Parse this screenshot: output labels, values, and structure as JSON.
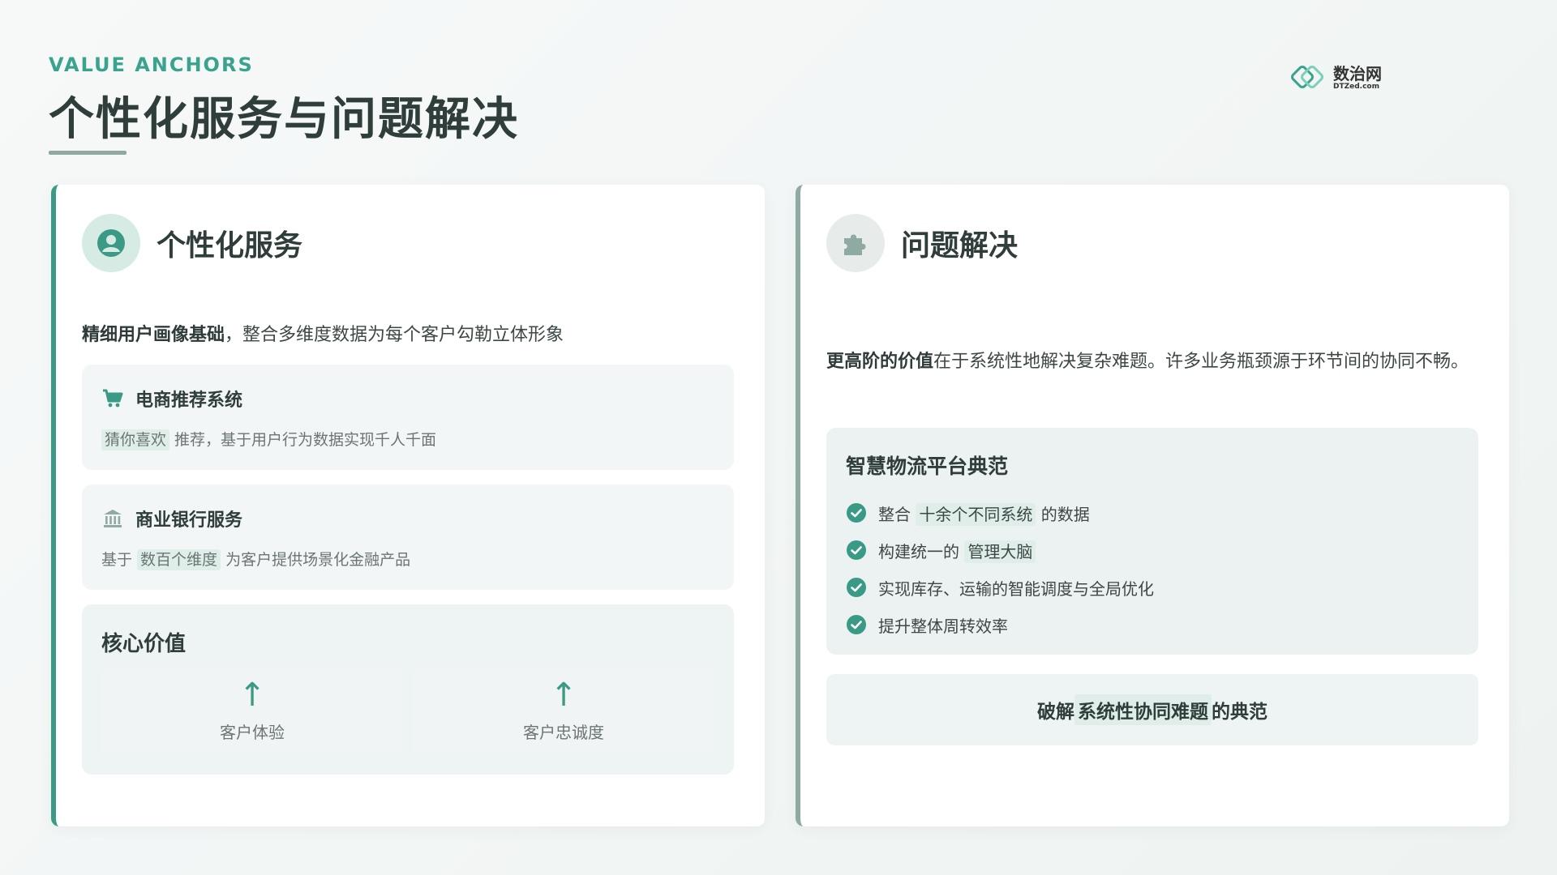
{
  "header": {
    "eyebrow": "VALUE ANCHORS",
    "title": "个性化服务与问题解决",
    "logo_cn": "数治网",
    "logo_en": "DTZed.com"
  },
  "colors": {
    "accent": "#3a9a86",
    "accent_muted": "#8fa9a3",
    "highlight_bg": "#e0eeea"
  },
  "left_card": {
    "title": "个性化服务",
    "icon": "user-circle-icon",
    "intro_bold": "精细用户画像基础",
    "intro_rest": "，整合多维度数据为每个客户勾勒立体形象",
    "features": [
      {
        "icon": "shopping-cart-icon",
        "title": "电商推荐系统",
        "desc_pre": "",
        "desc_highlight": "猜你喜欢",
        "desc_post": " 推荐，基于用户行为数据实现千人千面"
      },
      {
        "icon": "bank-icon",
        "title": "商业银行服务",
        "desc_pre": "基于 ",
        "desc_highlight": "数百个维度",
        "desc_post": " 为客户提供场景化金融产品"
      }
    ],
    "core": {
      "title": "核心价值",
      "metrics": [
        {
          "arrow": "↑",
          "label": "客户体验"
        },
        {
          "arrow": "↑",
          "label": "客户忠诚度"
        }
      ]
    }
  },
  "right_card": {
    "title": "问题解决",
    "icon": "puzzle-icon",
    "intro_bold": "更高阶的价值",
    "intro_rest": "在于系统性地解决复杂难题。许多业务瓶颈源于环节间的协同不畅。",
    "platform": {
      "title": "智慧物流平台典范",
      "items": [
        {
          "pre": "整合 ",
          "highlight": "十余个不同系统",
          "post": " 的数据"
        },
        {
          "pre": "构建统一的 ",
          "highlight": "管理大脑",
          "post": ""
        },
        {
          "pre": "实现库存、运输的智能调度与全局优化",
          "highlight": "",
          "post": ""
        },
        {
          "pre": "提升整体周转效率",
          "highlight": "",
          "post": ""
        }
      ]
    },
    "banner": {
      "pre": "破解 ",
      "highlight": "系统性协同难题",
      "post": " 的典范"
    }
  }
}
